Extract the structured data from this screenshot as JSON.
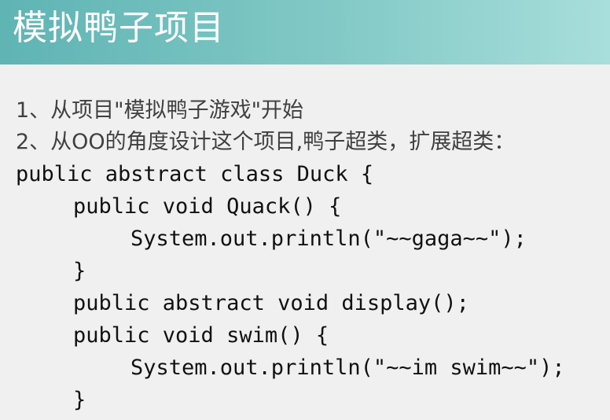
{
  "slide": {
    "title": "模拟鸭子项目",
    "bullets": [
      "1、从项目\"模拟鸭子游戏\"开始",
      "2、从OO的角度设计这个项目,鸭子超类，扩展超类："
    ],
    "code": [
      "public abstract class Duck {",
      "public void Quack() {",
      "System.out.println(\"~~gaga~~\");",
      "}",
      "public abstract void display();",
      "public void swim() {",
      "System.out.println(\"~~im swim~~\");",
      "}"
    ]
  }
}
